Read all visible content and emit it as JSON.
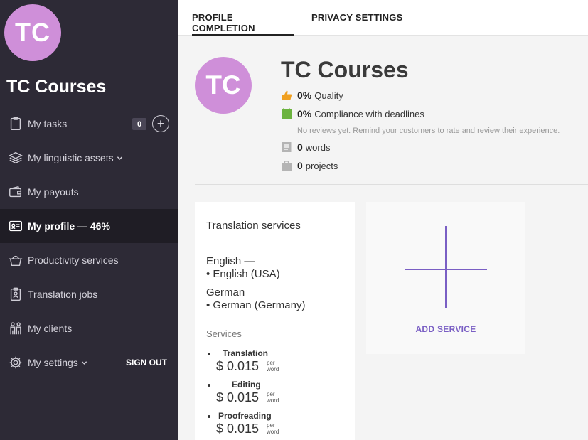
{
  "sidebar": {
    "avatar_initials": "TC",
    "user_name": "TC Courses",
    "items": [
      {
        "label": "My tasks",
        "icon": "clipboard-icon",
        "badge": "0"
      },
      {
        "label": "My linguistic assets",
        "icon": "layers-icon"
      },
      {
        "label": "My payouts",
        "icon": "wallet-icon"
      },
      {
        "label": "My profile — 46%",
        "icon": "id-card-icon"
      },
      {
        "label": "Productivity services",
        "icon": "basket-icon"
      },
      {
        "label": "Translation jobs",
        "icon": "clipboard-person-icon"
      },
      {
        "label": "My clients",
        "icon": "people-icon"
      },
      {
        "label": "My settings",
        "icon": "gear-icon"
      }
    ],
    "sign_out": "SIGN OUT",
    "plus_symbol": "+"
  },
  "tabs": [
    "PROFILE COMPLETION",
    "PRIVACY SETTINGS"
  ],
  "profile": {
    "avatar_initials": "TC",
    "name": "TC Courses",
    "quality_value": "0%",
    "quality_label": "Quality",
    "compliance_value": "0%",
    "compliance_label": "Compliance with deadlines",
    "note": "No reviews yet. Remind your customers to rate and review their experience.",
    "words_value": "0",
    "words_label": "words",
    "projects_value": "0",
    "projects_label": "projects"
  },
  "services_card": {
    "title": "Translation services",
    "lang1_source": "English —",
    "lang1_target": "• English (USA)",
    "lang2_source": "German",
    "lang2_target": "• German (Germany)",
    "services_heading": "Services",
    "services": [
      {
        "name": "Translation",
        "price": "$ 0.015",
        "unit_top": "per",
        "unit_bottom": "word"
      },
      {
        "name": "Editing",
        "price": "$ 0.015",
        "unit_top": "per",
        "unit_bottom": "word"
      },
      {
        "name": "Proofreading",
        "price": "$ 0.015",
        "unit_top": "per",
        "unit_bottom": "word"
      }
    ]
  },
  "add_service": {
    "label": "ADD SERVICE"
  },
  "colors": {
    "sidebar_bg": "#2d2a36",
    "avatar": "#cf8fd9",
    "accent": "#7a5fc4",
    "quality_icon": "#f0a020",
    "compliance_icon": "#6cb33f"
  }
}
